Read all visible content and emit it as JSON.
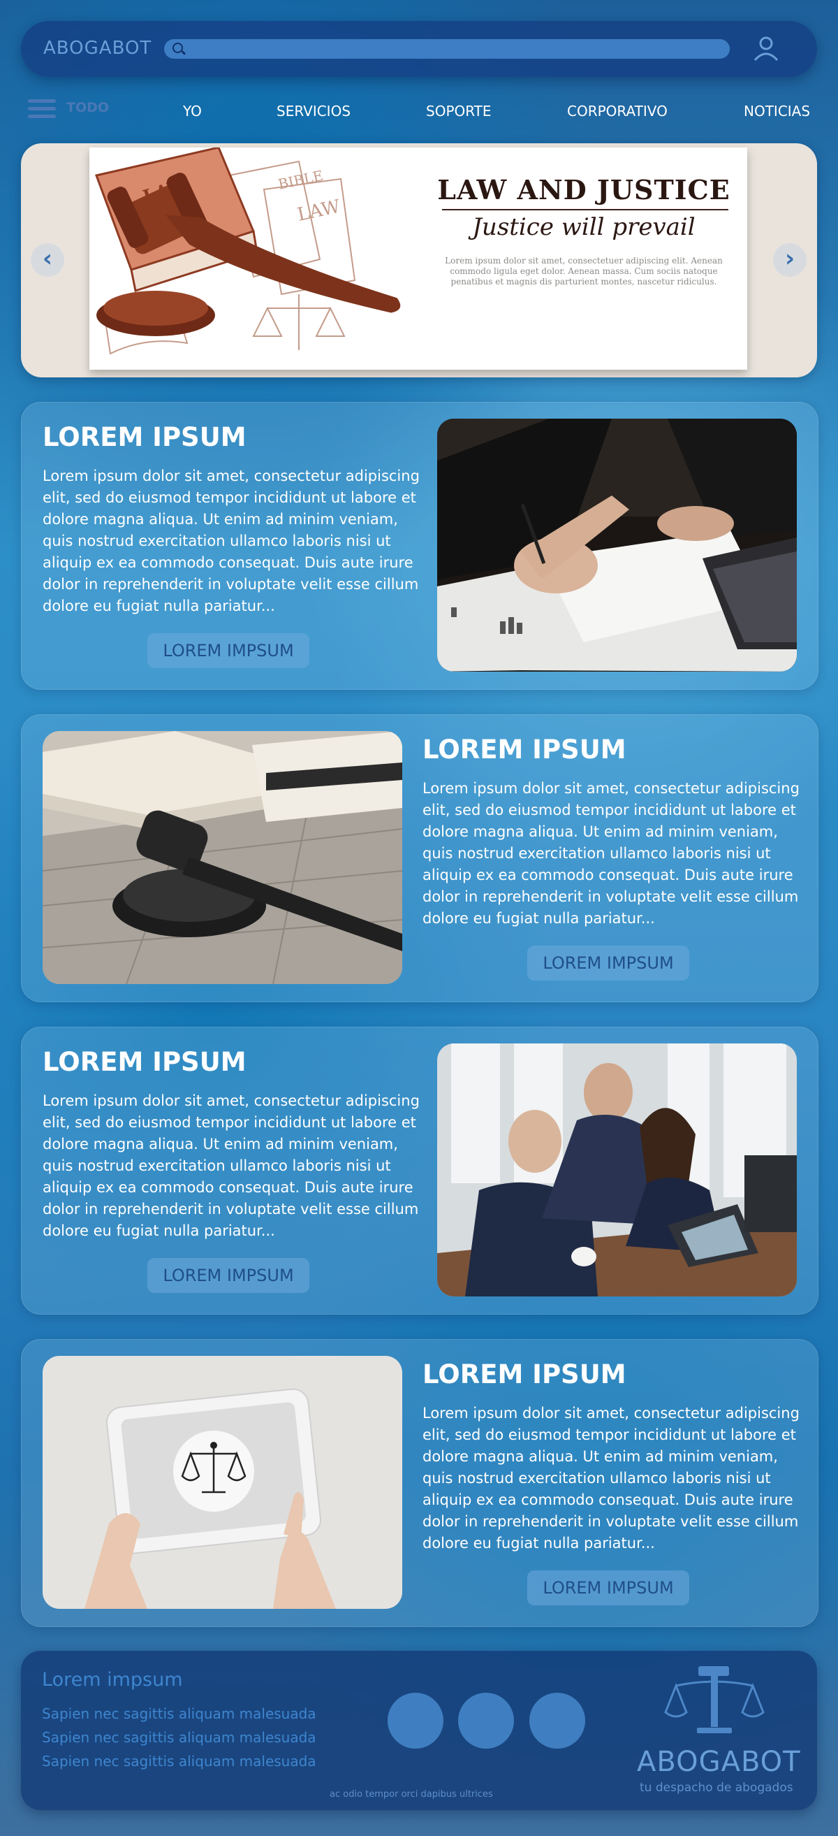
{
  "header": {
    "brand": "ABOGABOT",
    "search_placeholder": ""
  },
  "nav": {
    "menu_label": "TODO",
    "items": [
      "YO",
      "SERVICIOS",
      "SOPORTE",
      "CORPORATIVO",
      "NOTICIAS"
    ]
  },
  "hero": {
    "title": "LAW AND JUSTICE",
    "subtitle": "Justice will prevail",
    "body": "Lorem ipsum dolor sit amet, consectetuer adipiscing elit. Aenean commodo ligula eget dolor. Aenean massa. Cum sociis natoque penatibus et magnis dis parturient montes, nascetur ridiculus.",
    "book_label_law": "LAW",
    "book_label_bible": "BIBLE",
    "book_label_law2": "LAW"
  },
  "cards": [
    {
      "title": "LOREM IPSUM",
      "text": "Lorem ipsum dolor sit amet, consectetur adipiscing elit, sed do eiusmod tempor incididunt ut labore et dolore magna aliqua. Ut enim ad minim veniam, quis nostrud exercitation ullamco laboris nisi ut aliquip ex ea commodo consequat. Duis aute irure dolor in reprehenderit in voluptate velit esse cillum dolore eu fugiat nulla pariatur...",
      "button": "LOREM IMPSUM"
    },
    {
      "title": "LOREM IPSUM",
      "text": "Lorem ipsum dolor sit amet, consectetur adipiscing elit, sed do eiusmod tempor incididunt ut labore et dolore magna aliqua. Ut enim ad minim veniam, quis nostrud exercitation ullamco laboris nisi ut aliquip ex ea commodo consequat. Duis aute irure dolor in reprehenderit in voluptate velit esse cillum dolore eu fugiat nulla pariatur...",
      "button": "LOREM IMPSUM"
    },
    {
      "title": "LOREM IPSUM",
      "text": "Lorem ipsum dolor sit amet, consectetur adipiscing elit, sed do eiusmod tempor incididunt ut labore et dolore magna aliqua. Ut enim ad minim veniam, quis nostrud exercitation ullamco laboris nisi ut aliquip ex ea commodo consequat. Duis aute irure dolor in reprehenderit in voluptate velit esse cillum dolore eu fugiat nulla pariatur...",
      "button": "LOREM IMPSUM"
    },
    {
      "title": "LOREM IPSUM",
      "text": "Lorem ipsum dolor sit amet, consectetur adipiscing elit, sed do eiusmod tempor incididunt ut labore et dolore magna aliqua. Ut enim ad minim veniam, quis nostrud exercitation ullamco laboris nisi ut aliquip ex ea commodo consequat. Duis aute irure dolor in reprehenderit in voluptate velit esse cillum dolore eu fugiat nulla pariatur...",
      "button": "LOREM IMPSUM"
    }
  ],
  "footer": {
    "title": "Lorem impsum",
    "links": [
      "Sapien nec sagittis aliquam malesuada",
      "Sapien nec sagittis aliquam malesuada",
      "Sapien nec sagittis aliquam malesuada"
    ],
    "brand": "ABOGABOT",
    "tagline": "tu despacho de abogados",
    "note": "ac odio tempor orci dapibus ultrices"
  },
  "icons": {
    "search": "search-icon",
    "user": "user-icon",
    "menu": "hamburger-menu-icon",
    "prev": "chevron-left-icon",
    "next": "chevron-right-icon",
    "logo": "scales-of-justice-icon"
  },
  "colors": {
    "header_bg": "#143c82",
    "accent_blue": "#3e86cf",
    "button_text": "#1f4f88"
  }
}
